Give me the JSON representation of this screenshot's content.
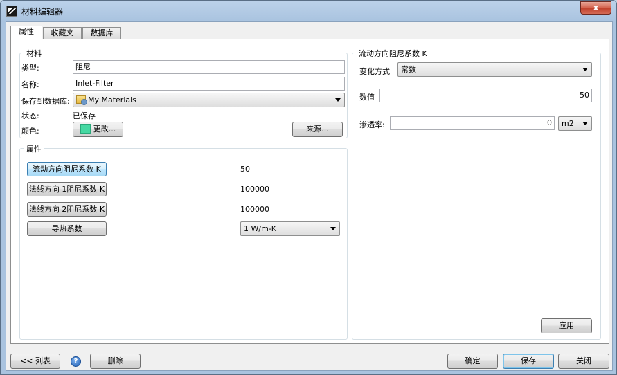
{
  "window": {
    "title": "材料编辑器",
    "close_glyph": "x"
  },
  "tabs": [
    {
      "label": "属性"
    },
    {
      "label": "收藏夹"
    },
    {
      "label": "数据库"
    }
  ],
  "material": {
    "group_title": "材料",
    "type_label": "类型:",
    "type_value": "阻尼",
    "name_label": "名称:",
    "name_value": "Inlet-Filter",
    "db_label": "保存到数据库:",
    "db_value": "My Materials",
    "status_label": "状态:",
    "status_value": "已保存",
    "color_label": "颜色:",
    "color_button": "更改...",
    "color_hex": "#45d8a2",
    "source_button": "来源..."
  },
  "properties": {
    "group_title": "属性",
    "rows": [
      {
        "button": "流动方向阻尼系数 K",
        "value": "50"
      },
      {
        "button": "法线方向 1阻尼系数 K",
        "value": "100000"
      },
      {
        "button": "法线方向 2阻尼系数 K",
        "value": "100000"
      },
      {
        "button": "导热系数",
        "value": "1 W/m-K"
      }
    ]
  },
  "detail": {
    "group_title": "流动方向阻尼系数 K",
    "variation_label": "变化方式",
    "variation_value": "常数",
    "numeric_label": "数值",
    "numeric_value": "50",
    "permeability_label": "渗透率:",
    "permeability_value": "0",
    "permeability_unit": "m2",
    "apply_button": "应用"
  },
  "footer": {
    "list_button": "<< 列表",
    "help_glyph": "?",
    "delete_button": "删除",
    "ok_button": "确定",
    "save_button": "保存",
    "close_button": "关闭"
  }
}
